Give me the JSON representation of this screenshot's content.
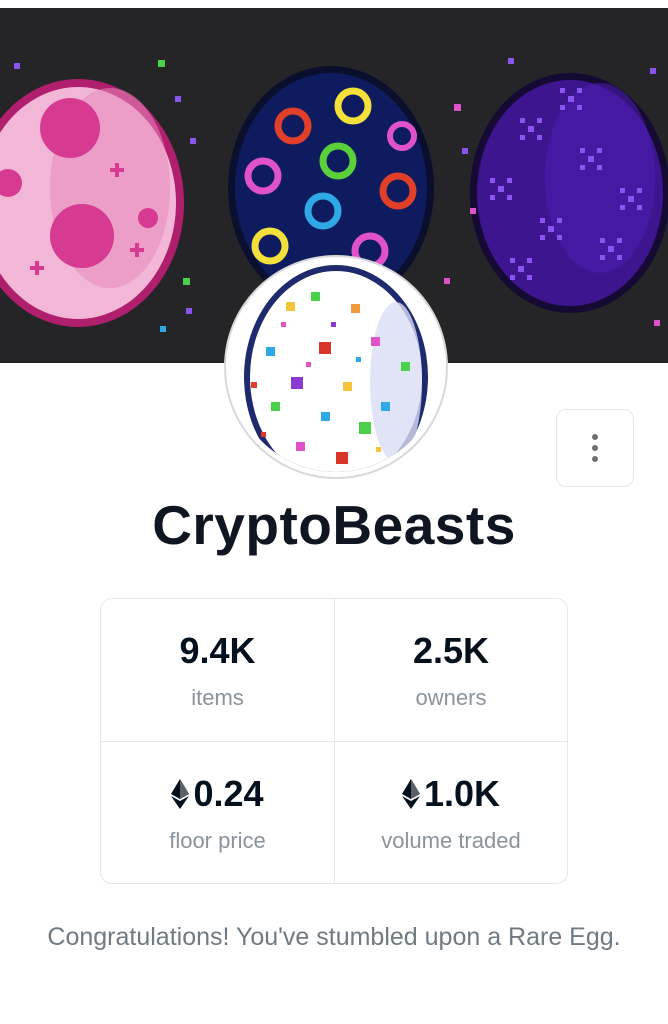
{
  "collection": {
    "name": "CryptoBeasts",
    "description": "Congratulations! You've stumbled upon a Rare Egg."
  },
  "stats": [
    {
      "value": "9.4K",
      "label": "items",
      "currency_icon": null
    },
    {
      "value": "2.5K",
      "label": "owners",
      "currency_icon": null
    },
    {
      "value": "0.24",
      "label": "floor price",
      "currency_icon": "ethereum-icon"
    },
    {
      "value": "1.0K",
      "label": "volume traded",
      "currency_icon": "ethereum-icon"
    }
  ],
  "more_button": {
    "icon": "more-vertical-icon"
  },
  "colors": {
    "banner_bg": "#252527",
    "title": "#0f1621",
    "muted_text": "#8a939b",
    "border": "#e5e8eb"
  }
}
